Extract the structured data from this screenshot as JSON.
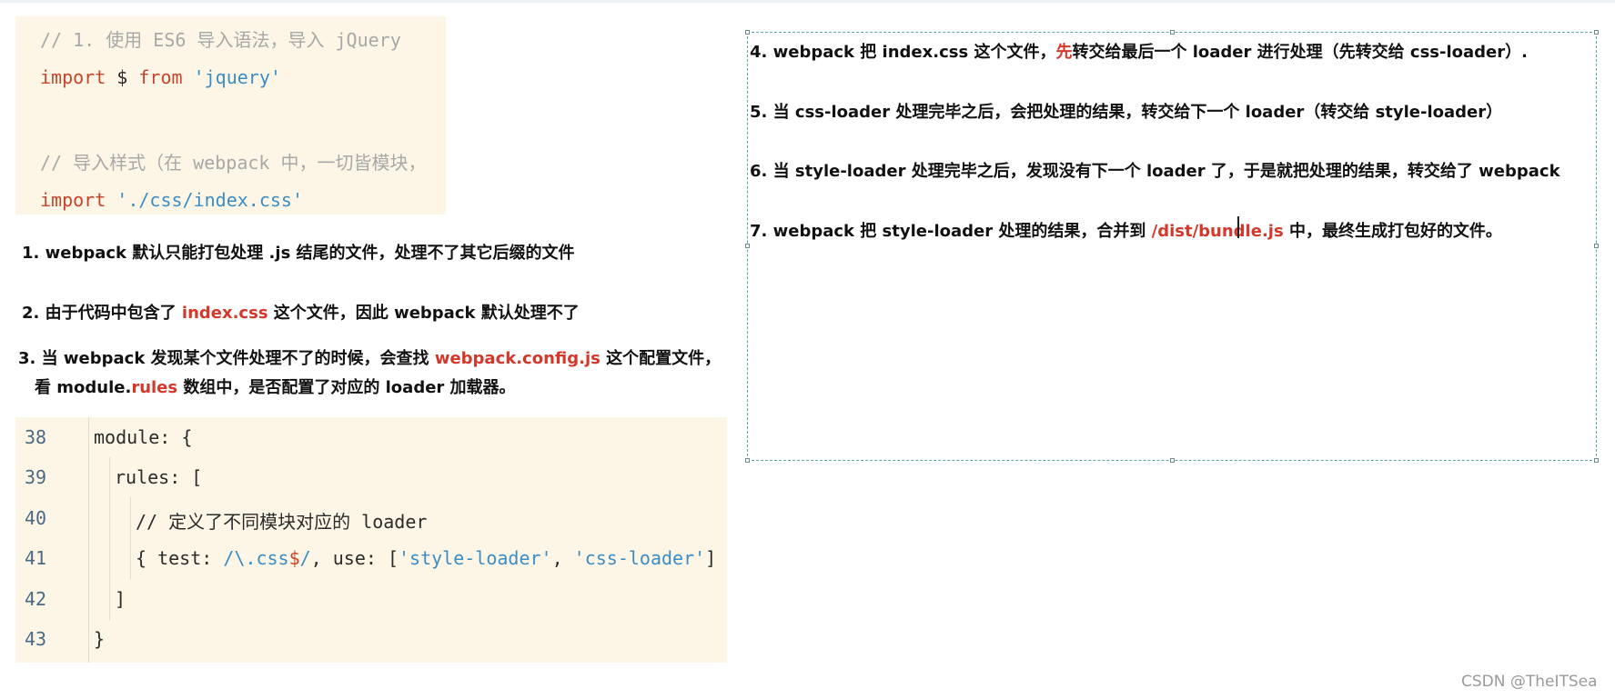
{
  "code_block_1": {
    "line1": "// 1. 使用 ES6 导入语法，导入 jQuery",
    "line2_kw": "import",
    "line2_mid": " $ ",
    "line2_kw2": "from",
    "line2_str": " 'jquery'",
    "line3": "// 导入样式（在 webpack 中，一切皆模块，",
    "line4_kw": "import",
    "line4_str": " './css/index.css'"
  },
  "left_notes": {
    "note1": "1. webpack 默认只能打包处理 .js 结尾的文件，处理不了其它后缀的文件",
    "note2_a": "2. 由于代码中包含了 ",
    "note2_hl": "index.css",
    "note2_b": " 这个文件，因此 webpack 默认处理不了",
    "note3_a": "3. 当 webpack 发现某个文件处理不了的时候，会查找 ",
    "note3_hl": "webpack.config.js",
    "note3_b": " 这个配置文件，",
    "note3_line2_a": "看 module.",
    "note3_line2_hl": "rules",
    "note3_line2_b": " 数组中，是否配置了对应的 loader 加载器。"
  },
  "code_block_2": {
    "lines": [
      {
        "num": "38",
        "text": "module: {"
      },
      {
        "num": "39",
        "text": "rules: ["
      },
      {
        "num": "40",
        "text": "// 定义了不同模块对应的 loader"
      },
      {
        "num": "41",
        "text_a": "{ test: ",
        "regex_a": "/\\.css",
        "regex_b": "$",
        "regex_c": "/",
        "text_b": ", use: [",
        "str1": "'style-loader'",
        "text_c": ", ",
        "str2": "'css-loader'",
        "text_d": "] }"
      },
      {
        "num": "42",
        "text": "]"
      },
      {
        "num": "43",
        "text": "}"
      }
    ]
  },
  "right_notes": {
    "note4_a": "4. webpack 把 index.css 这个文件，",
    "note4_hl": "先",
    "note4_b": "转交给最后一个 loader 进行处理（先转交给 css-loader）.",
    "note5": "5. 当 css-loader 处理完毕之后，会把处理的结果，转交给下一个 loader（转交给 style-loader）",
    "note6": "6. 当 style-loader 处理完毕之后，发现没有下一个 loader 了，于是就把处理的结果，转交给了 webpack",
    "note7_a": "7. webpack 把 style-loader 处理的结果，合并到 ",
    "note7_hl": "/dist/bundle.js",
    "note7_b": " 中，最终生成打包好的文件。"
  },
  "watermark": "CSDN @TheITSea",
  "colors": {
    "highlight": "#d4382b",
    "keyword": "#c7442a",
    "string": "#3c8dc4",
    "comment": "#a8a8a8",
    "code_bg": "#fdf6e6"
  }
}
